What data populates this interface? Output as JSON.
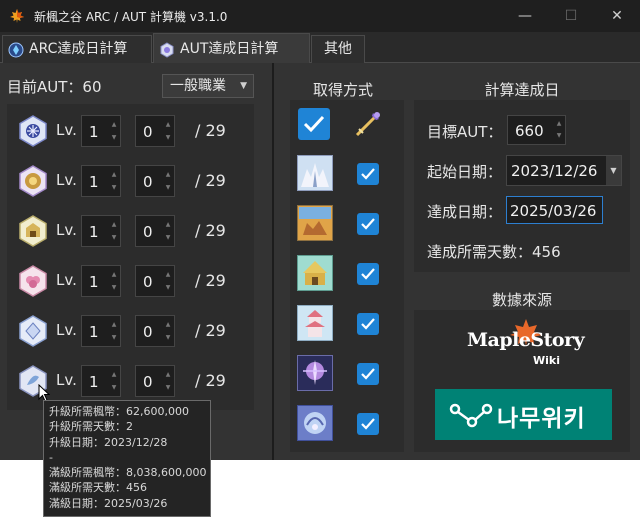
{
  "window": {
    "title": "新楓之谷 ARC / AUT 計算機  v3.1.0"
  },
  "tabs": [
    {
      "label": "ARC達成日計算"
    },
    {
      "label": "AUT達成日計算"
    },
    {
      "label": "其他"
    }
  ],
  "left": {
    "aut_text": "目前AUT：60",
    "job_select": "一般職業",
    "rows": [
      {
        "lv_label": "Lv.",
        "level": "1",
        "exp": "0",
        "max": "/ 29",
        "icon": "cernium-symbol-icon"
      },
      {
        "lv_label": "Lv.",
        "level": "1",
        "exp": "0",
        "max": "/ 29",
        "icon": "hotel-arcus-symbol-icon"
      },
      {
        "lv_label": "Lv.",
        "level": "1",
        "exp": "0",
        "max": "/ 29",
        "icon": "odium-symbol-icon"
      },
      {
        "lv_label": "Lv.",
        "level": "1",
        "exp": "0",
        "max": "/ 29",
        "icon": "shangri-la-symbol-icon"
      },
      {
        "lv_label": "Lv.",
        "level": "1",
        "exp": "0",
        "max": "/ 29",
        "icon": "arteria-symbol-icon"
      },
      {
        "lv_label": "Lv.",
        "level": "1",
        "exp": "0",
        "max": "/ 29",
        "icon": "carcion-symbol-icon"
      }
    ],
    "tooltip": [
      "升級所需楓幣：62,600,000",
      "升級所需天數：2",
      "升級日期：2023/12/28",
      "-",
      "滿級所需楓幣：8,038,600,000",
      "滿級所需天數：456",
      "滿級日期：2025/03/26"
    ]
  },
  "sources": {
    "title": "取得方式",
    "header_checked": true,
    "items": [
      {
        "icon": "cernium-map-icon",
        "checked": true
      },
      {
        "icon": "arcus-map-icon",
        "checked": true
      },
      {
        "icon": "odium-map-icon",
        "checked": true
      },
      {
        "icon": "shangri-la-map-icon",
        "checked": true
      },
      {
        "icon": "arteria-map-icon",
        "checked": true
      },
      {
        "icon": "carcion-map-icon",
        "checked": true
      }
    ]
  },
  "calc": {
    "title": "計算達成日",
    "target_label": "目標AUT：",
    "target_value": "660",
    "start_label": "起始日期：",
    "start_value": "2023/12/26",
    "end_label": "達成日期：",
    "end_value": "2025/03/26",
    "days_text": "達成所需天數：456"
  },
  "data_source": {
    "title": "數據來源",
    "maplestory_text": "MapleStory",
    "maplestory_sub": "Wiki",
    "namu_text": "나무위키"
  },
  "colors": {
    "accent": "#1f84d6",
    "namu": "#008275"
  }
}
